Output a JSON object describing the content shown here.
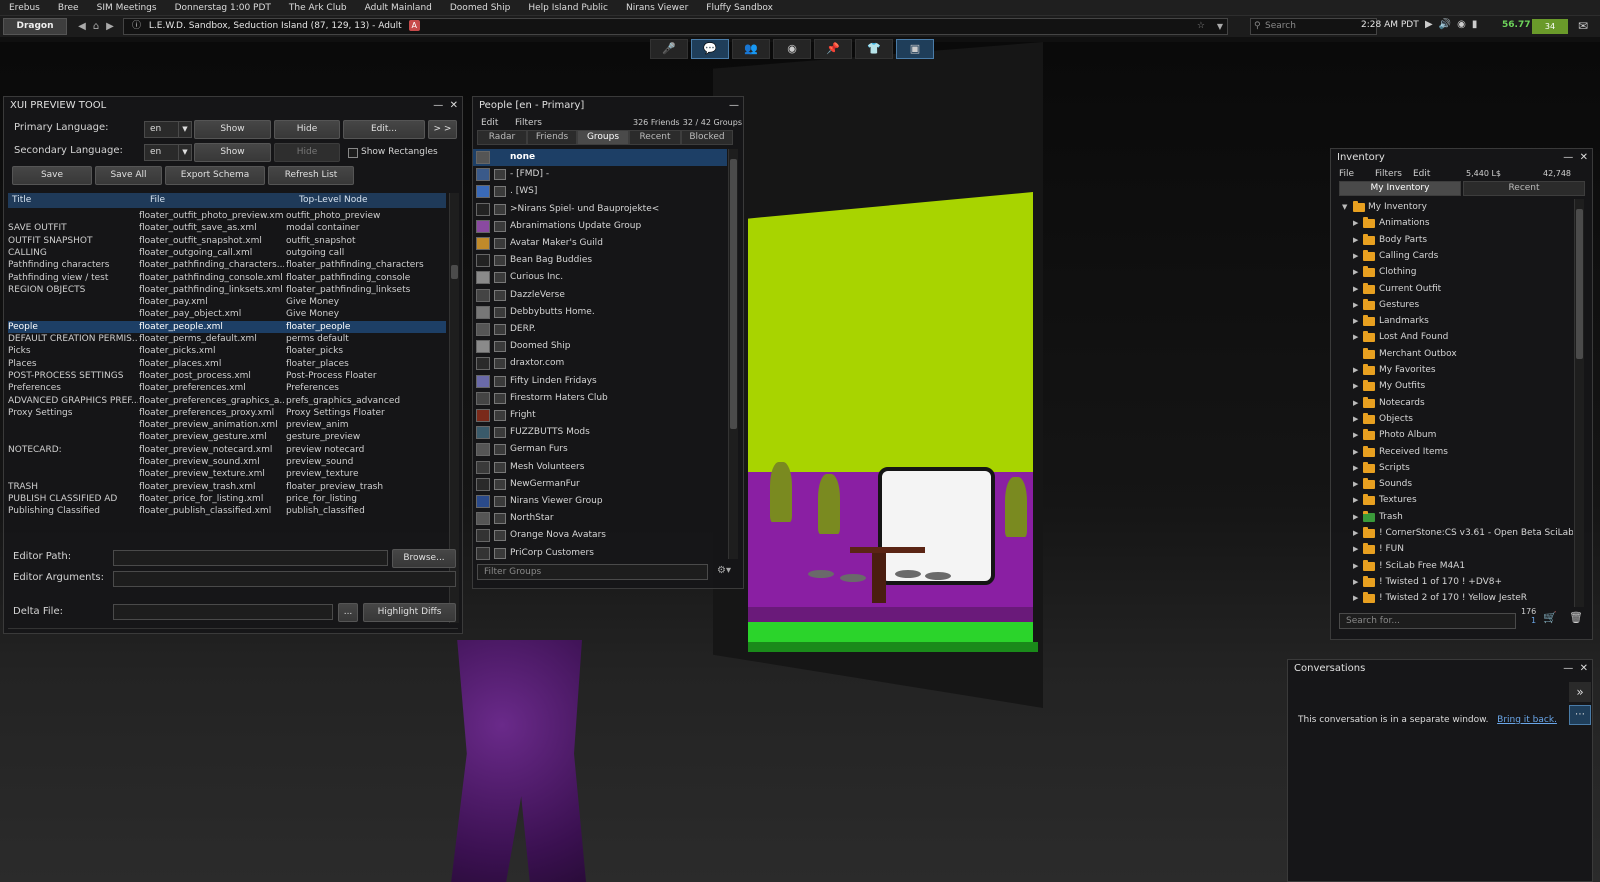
{
  "topbar": {
    "items": [
      "Erebus",
      "Bree",
      "SIM Meetings",
      "Donnerstag 1:00 PDT",
      "The Ark Club",
      "Adult Mainland",
      "Doomed Ship",
      "Help Island Public",
      "Nirans Viewer",
      "Fluffy Sandbox"
    ]
  },
  "navbar": {
    "home_label": "Dragon",
    "location": "L.E.W.D. Sandbox, Seduction Island (87, 129, 13) - Adult",
    "maturity_badge": "A",
    "search_placeholder": "Search",
    "time": "2:28 AM PDT",
    "fps": "56.77",
    "status_count": "34"
  },
  "xui": {
    "title": "XUI PREVIEW TOOL",
    "primary_label": "Primary Language:",
    "secondary_label": "Secondary Language:",
    "primary_lang": "en",
    "secondary_lang": "en",
    "show": "Show",
    "hide": "Hide",
    "edit": "Edit...",
    "more": "> >",
    "show_rect": "Show Rectangles",
    "save": "Save",
    "save_all": "Save All",
    "export_schema": "Export Schema",
    "refresh_list": "Refresh List",
    "col_title": "Title",
    "col_file": "File",
    "col_node": "Top-Level Node",
    "rows": [
      {
        "title": "",
        "file": "floater_outfit_photo_preview.xml",
        "node": "outfit_photo_preview"
      },
      {
        "title": "SAVE OUTFIT",
        "file": "floater_outfit_save_as.xml",
        "node": "modal container"
      },
      {
        "title": "OUTFIT SNAPSHOT",
        "file": "floater_outfit_snapshot.xml",
        "node": "outfit_snapshot"
      },
      {
        "title": "CALLING",
        "file": "floater_outgoing_call.xml",
        "node": "outgoing call"
      },
      {
        "title": "Pathfinding characters",
        "file": "floater_pathfinding_characters...",
        "node": "floater_pathfinding_characters"
      },
      {
        "title": "Pathfinding view / test",
        "file": "floater_pathfinding_console.xml",
        "node": "floater_pathfinding_console"
      },
      {
        "title": "REGION OBJECTS",
        "file": "floater_pathfinding_linksets.xml",
        "node": "floater_pathfinding_linksets"
      },
      {
        "title": "",
        "file": "floater_pay.xml",
        "node": "Give Money"
      },
      {
        "title": "",
        "file": "floater_pay_object.xml",
        "node": "Give Money"
      },
      {
        "title": "People",
        "file": "floater_people.xml",
        "node": "floater_people"
      },
      {
        "title": "DEFAULT CREATION PERMIS...",
        "file": "floater_perms_default.xml",
        "node": "perms default"
      },
      {
        "title": "Picks",
        "file": "floater_picks.xml",
        "node": "floater_picks"
      },
      {
        "title": "Places",
        "file": "floater_places.xml",
        "node": "floater_places"
      },
      {
        "title": "POST-PROCESS SETTINGS",
        "file": "floater_post_process.xml",
        "node": "Post-Process Floater"
      },
      {
        "title": "Preferences",
        "file": "floater_preferences.xml",
        "node": "Preferences"
      },
      {
        "title": "ADVANCED GRAPHICS PREF...",
        "file": "floater_preferences_graphics_a...",
        "node": "prefs_graphics_advanced"
      },
      {
        "title": "Proxy Settings",
        "file": "floater_preferences_proxy.xml",
        "node": "Proxy Settings Floater"
      },
      {
        "title": "",
        "file": "floater_preview_animation.xml",
        "node": "preview_anim"
      },
      {
        "title": "",
        "file": "floater_preview_gesture.xml",
        "node": "gesture_preview"
      },
      {
        "title": "NOTECARD:",
        "file": "floater_preview_notecard.xml",
        "node": "preview notecard"
      },
      {
        "title": "",
        "file": "floater_preview_sound.xml",
        "node": "preview_sound"
      },
      {
        "title": "",
        "file": "floater_preview_texture.xml",
        "node": "preview_texture"
      },
      {
        "title": "TRASH",
        "file": "floater_preview_trash.xml",
        "node": "floater_preview_trash"
      },
      {
        "title": "PUBLISH CLASSIFIED AD",
        "file": "floater_price_for_listing.xml",
        "node": "price_for_listing"
      },
      {
        "title": "Publishing Classified",
        "file": "floater_publish_classified.xml",
        "node": "publish_classified"
      }
    ],
    "editor_path": "Editor Path:",
    "browse": "Browse...",
    "editor_args": "Editor Arguments:",
    "delta_file": "Delta File:",
    "dots": "...",
    "highlight": "Highlight Diffs"
  },
  "people": {
    "title": "People [en - Primary]",
    "menu_edit": "Edit",
    "menu_filters": "Filters",
    "friends_count": "326 Friends",
    "groups_count": "32 / 42 Groups",
    "tabs": [
      "Radar",
      "Friends",
      "Groups",
      "Recent",
      "Blocked"
    ],
    "groups": [
      "none",
      "- [FMD] -",
      ". [WS]",
      ">Nirans Spiel- und Bauprojekte<",
      "Abranimations Update Group",
      "Avatar Maker's Guild",
      "Bean Bag Buddies",
      "Curious Inc.",
      "DazzleVerse",
      "Debbybutts Home.",
      "DERP.",
      "Doomed Ship",
      "draxtor.com",
      "Fifty Linden Fridays",
      "Firestorm Haters Club",
      "Fright",
      "FUZZBUTTS Mods",
      "German Furs",
      "Mesh Volunteers",
      "NewGermanFur",
      "Nirans Viewer Group",
      "NorthStar",
      "Orange Nova Avatars",
      "PriCorp Customers"
    ],
    "filter_placeholder": "Filter Groups"
  },
  "inventory": {
    "title": "Inventory",
    "menu_file": "File",
    "menu_filters": "Filters",
    "menu_edit": "Edit",
    "balance": "5,440 L$",
    "item_count": "42,748",
    "tab_my": "My Inventory",
    "tab_recent": "Recent",
    "root": "My Inventory",
    "folders": [
      "Animations",
      "Body Parts",
      "Calling Cards",
      "Clothing",
      "Current Outfit",
      "Gestures",
      "Landmarks",
      "Lost And Found",
      "Merchant Outbox",
      "My Favorites",
      "My Outfits",
      "Notecards",
      "Objects",
      "Photo Album",
      "Received Items",
      "Scripts",
      "Sounds",
      "Textures",
      "Trash",
      "! CornerStone:CS v3.61 - Open Beta SciLab",
      "! FUN",
      "! SciLab Free M4A1",
      "! Twisted 1 of 170 ! +DV8+",
      "! Twisted 2 of 170 ! Yellow JesteR"
    ],
    "search_placeholder": "Search for...",
    "count_top": "176",
    "count_bottom": "1"
  },
  "conversations": {
    "title": "Conversations",
    "message": "This conversation is in a separate window.",
    "link": "Bring it back."
  }
}
